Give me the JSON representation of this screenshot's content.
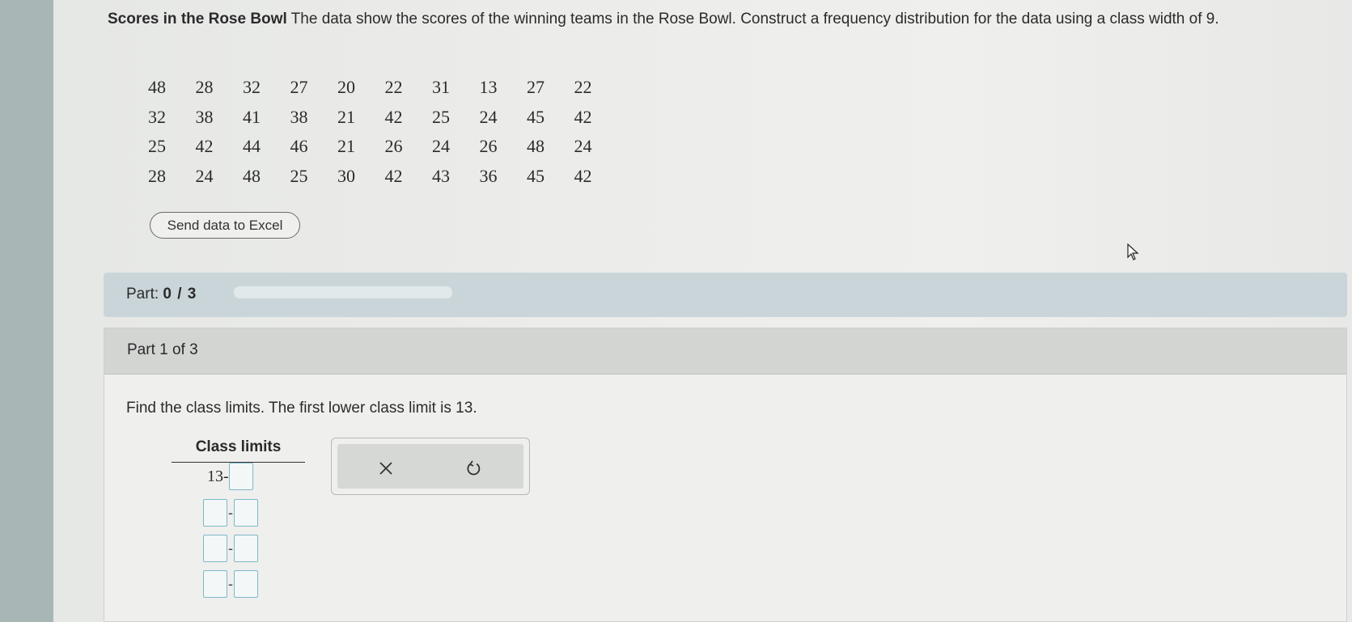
{
  "problem": {
    "title": "Scores in the Rose Bowl",
    "text": " The data show the scores of the winning teams in the Rose Bowl. Construct a frequency distribution for the data using a class width of 9."
  },
  "data_rows": [
    [
      "48",
      "28",
      "32",
      "27",
      "20",
      "22",
      "31",
      "13",
      "27",
      "22"
    ],
    [
      "32",
      "38",
      "41",
      "38",
      "21",
      "42",
      "25",
      "24",
      "45",
      "42"
    ],
    [
      "25",
      "42",
      "44",
      "46",
      "21",
      "26",
      "24",
      "26",
      "48",
      "24"
    ],
    [
      "28",
      "24",
      "48",
      "25",
      "30",
      "42",
      "43",
      "36",
      "45",
      "42"
    ]
  ],
  "excel_button": "Send data to Excel",
  "part_progress": {
    "label": "Part:",
    "value": "0 / 3",
    "fraction": 0
  },
  "part1": {
    "title": "Part 1 of 3",
    "instruction": "Find the class limits. The first lower class limit is 13.",
    "class_limits_header": "Class limits",
    "first_lower": "13",
    "dash": "-"
  },
  "icons": {
    "clear": "close-icon",
    "undo": "undo-icon"
  }
}
